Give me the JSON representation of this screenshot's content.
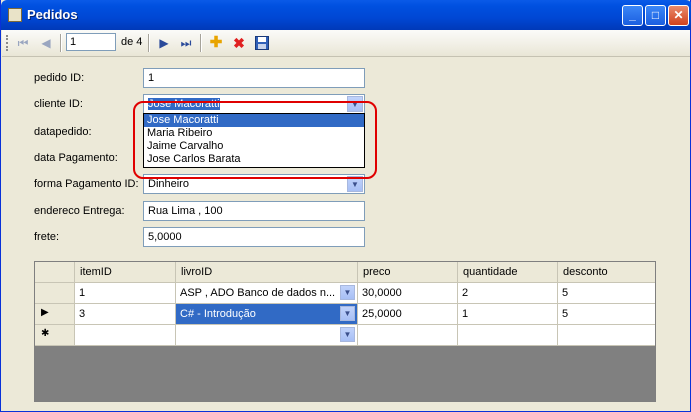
{
  "window": {
    "title": "Pedidos"
  },
  "toolbar": {
    "position": "1",
    "of_label": "de 4",
    "icons": [
      "move-first",
      "move-previous",
      "move-next",
      "move-last",
      "add-new",
      "delete",
      "save"
    ]
  },
  "form": {
    "pedido_id_label": "pedido ID:",
    "pedido_id_value": "1",
    "cliente_id_label": "cliente ID:",
    "cliente_id_value": "Jose Macoratti",
    "datapedido_label": "datapedido:",
    "data_pagamento_label": "data Pagamento:",
    "forma_pagamento_label": "forma Pagamento ID:",
    "forma_pagamento_value": "Dinheiro",
    "endereco_label": "endereco Entrega:",
    "endereco_value": "Rua Lima , 100",
    "frete_label": "frete:",
    "frete_value": "5,0000"
  },
  "cliente_dropdown": {
    "options": [
      "Jose Macoratti",
      "Maria Ribeiro",
      "Jaime Carvalho",
      "Jose Carlos Barata"
    ],
    "selected_index": 0
  },
  "grid": {
    "columns": [
      "itemID",
      "livroID",
      "preco",
      "quantidade",
      "desconto"
    ],
    "rows": [
      {
        "indicator": "",
        "itemID": "1",
        "livroID": "ASP , ADO Banco de dados n...",
        "preco": "30,0000",
        "quantidade": "2",
        "desconto": "5"
      },
      {
        "indicator": "▶",
        "itemID": "3",
        "livroID": "C# - Introdução",
        "preco": "25,0000",
        "quantidade": "1",
        "desconto": "5"
      },
      {
        "indicator": "✱",
        "itemID": "",
        "livroID": "",
        "preco": "",
        "quantidade": "",
        "desconto": ""
      }
    ]
  },
  "colors": {
    "titlebar": "#0050e0",
    "selection": "#316ac5",
    "annotation": "#e00000"
  }
}
